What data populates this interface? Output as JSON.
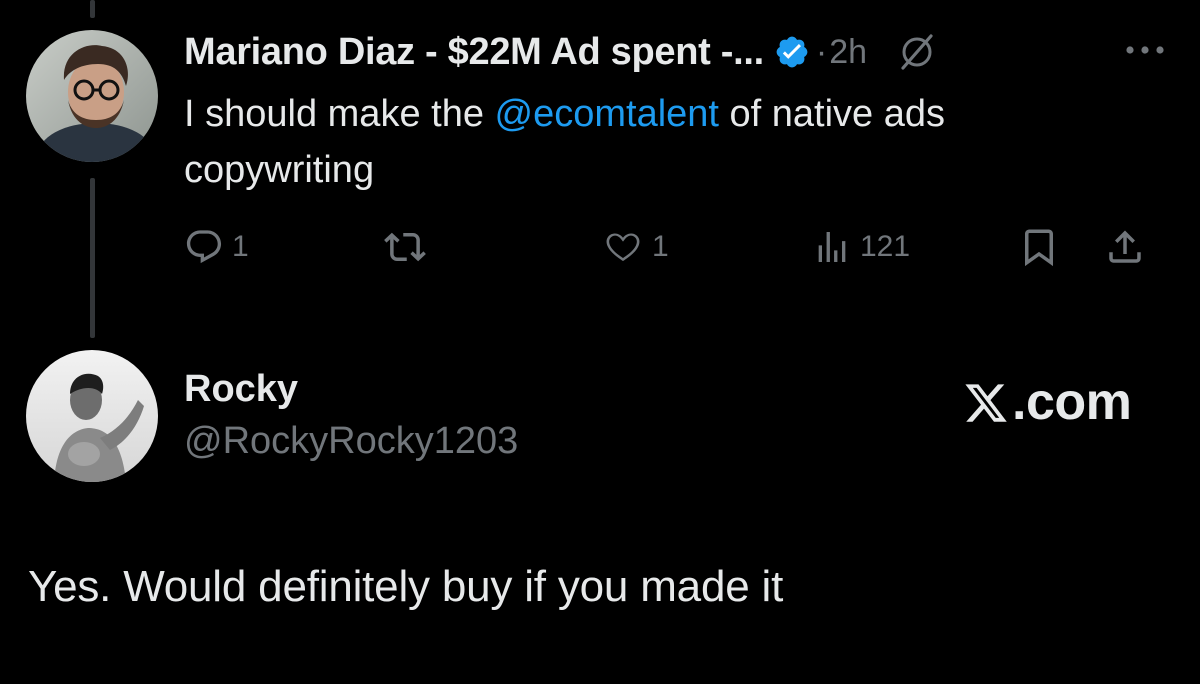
{
  "parent_tweet": {
    "author_name": "Mariano Diaz - $22M Ad spent -...",
    "separator": "·",
    "timestamp": "2h",
    "text_before": "I should make the ",
    "mention": "@ecomtalent",
    "text_after": " of native ads copywriting",
    "actions": {
      "replies": "1",
      "reposts": "",
      "likes": "1",
      "views": "121"
    },
    "icons": [
      "verified-badge-icon",
      "grok-icon",
      "more-icon",
      "reply-icon",
      "repost-icon",
      "like-icon",
      "views-icon",
      "bookmark-icon",
      "share-icon"
    ]
  },
  "reply_tweet": {
    "author_name": "Rocky",
    "handle": "@RockyRocky1203",
    "text": "Yes. Would definitely buy if you made it"
  },
  "branding": {
    "site_suffix": ".com"
  },
  "colors": {
    "background": "#000000",
    "primary_text": "#e7e9ea",
    "secondary_text": "#71767b",
    "accent": "#1d9bf0",
    "thread_line": "#333639"
  }
}
